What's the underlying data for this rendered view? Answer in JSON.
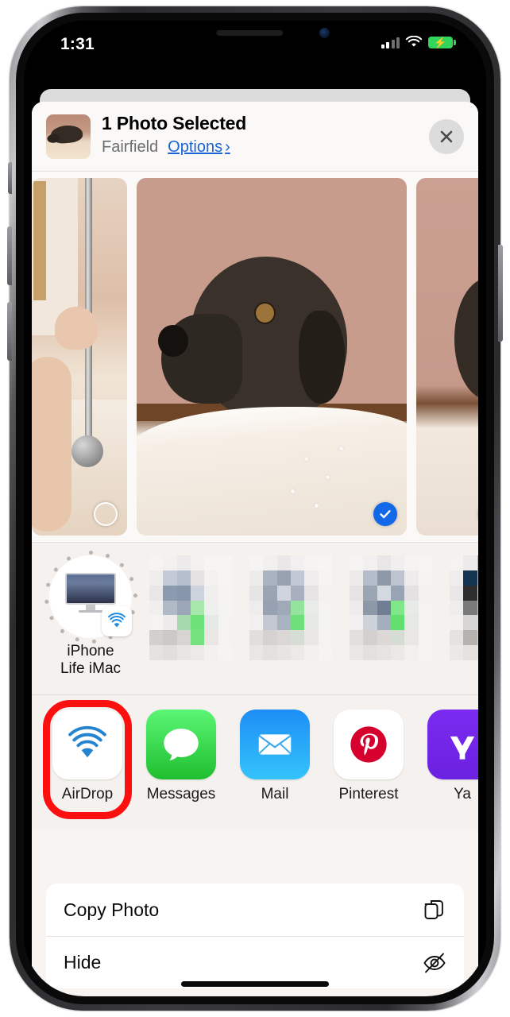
{
  "status_bar": {
    "time": "1:31",
    "cellular_icon": "cellular-signal-icon",
    "wifi_icon": "wifi-icon",
    "battery_icon": "battery-charging-icon",
    "battery_bolt": "⚡"
  },
  "share_sheet": {
    "header": {
      "title": "1 Photo Selected",
      "album": "Fairfield",
      "options_label": "Options",
      "options_chevron": "›",
      "close_icon": "close-x-icon",
      "thumbnail_name": "selected-photo-thumbnail"
    },
    "photos": [
      {
        "id": "photo-left",
        "selected": false,
        "alt": "bathroom-scene"
      },
      {
        "id": "photo-center",
        "selected": true,
        "alt": "dog-at-bathtub"
      },
      {
        "id": "photo-right",
        "selected": false,
        "alt": "dog-partial"
      }
    ],
    "airdrop": {
      "targets": [
        {
          "name": "iPhone Life iMac",
          "line1": "iPhone",
          "line2": "Life iMac",
          "icon": "imac-icon",
          "badge": "airdrop-badge-icon"
        }
      ],
      "blurred_contacts": 4
    },
    "apps": [
      {
        "name": "AirDrop",
        "icon": "airdrop-icon",
        "highlighted": true
      },
      {
        "name": "Messages",
        "icon": "messages-icon",
        "highlighted": false
      },
      {
        "name": "Mail",
        "icon": "mail-icon",
        "highlighted": false
      },
      {
        "name": "Pinterest",
        "icon": "pinterest-icon",
        "highlighted": false
      },
      {
        "name": "Ya",
        "icon": "yahoo-icon",
        "highlighted": false
      }
    ],
    "actions": [
      {
        "label": "Copy Photo",
        "icon": "copy-documents-icon"
      },
      {
        "label": "Hide",
        "icon": "eye-slash-icon"
      }
    ]
  },
  "colors": {
    "accent_blue": "#1268e8",
    "link_blue": "#1a63d8",
    "highlight_red": "#fb0f0f",
    "sheet_bg": "#f7f4f2",
    "battery_green": "#33d45c"
  }
}
